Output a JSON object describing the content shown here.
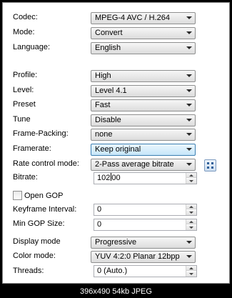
{
  "fields": {
    "codec": {
      "label": "Codec:",
      "value": "MPEG-4 AVC / H.264"
    },
    "mode": {
      "label": "Mode:",
      "value": "Convert"
    },
    "language": {
      "label": "Language:",
      "value": "English"
    },
    "profile": {
      "label": "Profile:",
      "value": "High"
    },
    "level": {
      "label": "Level:",
      "value": "Level 4.1"
    },
    "preset": {
      "label": "Preset",
      "value": "Fast"
    },
    "tune": {
      "label": "Tune",
      "value": "Disable"
    },
    "frame_packing": {
      "label": "Frame-Packing:",
      "value": "none"
    },
    "framerate": {
      "label": "Framerate:",
      "value": "Keep original"
    },
    "rate_control": {
      "label": "Rate control mode:",
      "value": "2-Pass average bitrate"
    },
    "bitrate": {
      "label": "Bitrate:",
      "value_before_cursor": "102",
      "value_after_cursor": "00"
    },
    "open_gop": {
      "label": "Open GOP",
      "checked": false
    },
    "keyframe_interval": {
      "label": "Keyframe Interval:",
      "value": "0"
    },
    "min_gop_size": {
      "label": "Min GOP Size:",
      "value": "0"
    },
    "display_mode": {
      "label": "Display mode",
      "value": "Progressive"
    },
    "color_mode": {
      "label": "Color mode:",
      "value": "YUV 4:2:0 Planar 12bpp"
    },
    "threads": {
      "label": "Threads:",
      "value": "0 (Auto.)"
    }
  },
  "footer": "396x490  54kb  JPEG",
  "icons": {
    "calculator": "bitrate-calculator-icon",
    "dropdown": "chevron-down-icon"
  },
  "colors": {
    "panel": "#ffffff",
    "focus": "#3c7fb1",
    "border": "#8a8a8a"
  }
}
